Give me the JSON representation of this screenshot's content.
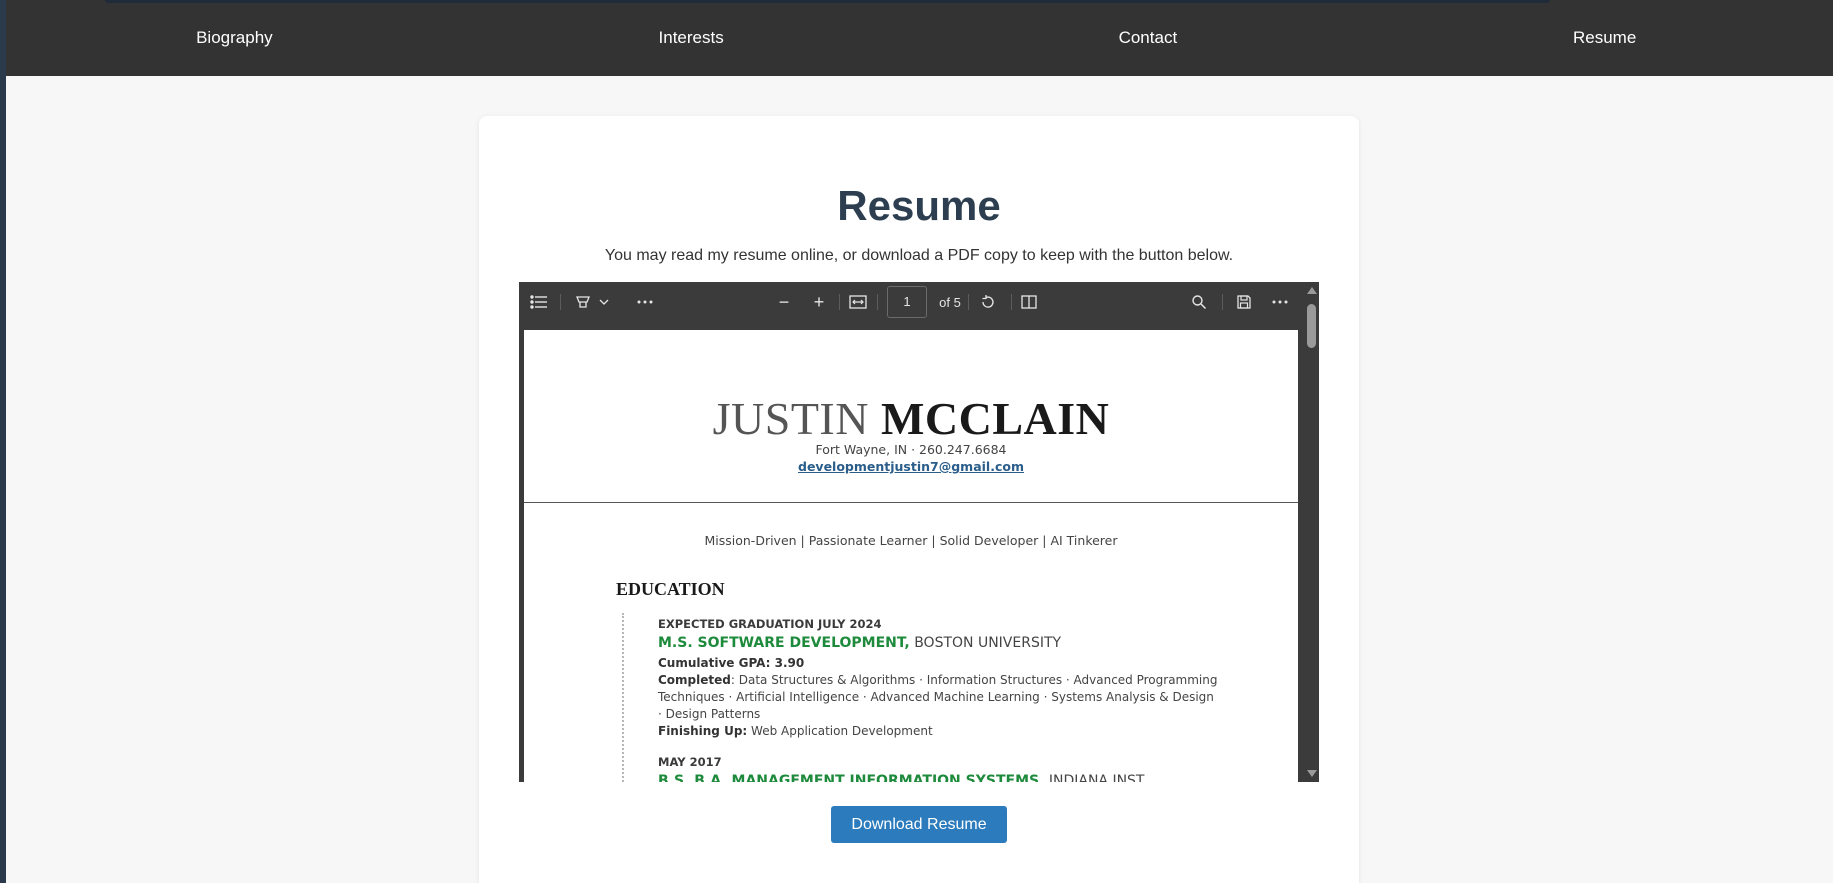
{
  "nav": {
    "items": [
      "Biography",
      "Interests",
      "Contact",
      "Resume"
    ]
  },
  "resume_section": {
    "title": "Resume",
    "subtitle": "You may read my resume online, or download a PDF copy to keep with the button below.",
    "download_label": "Download Resume"
  },
  "pdf_viewer": {
    "toolbar": {
      "contents_icon": "list-icon",
      "highlight_icon": "highlighter-icon",
      "more_icon": "more-icon",
      "zoom_out": "−",
      "zoom_in": "+",
      "fit_icon": "fit-width-icon",
      "current_page": "1",
      "page_total": "of 5",
      "rotate_icon": "rotate-icon",
      "page_view_icon": "page-view-icon",
      "search_icon": "search-icon",
      "save_icon": "save-icon"
    },
    "document": {
      "first_name": "JUSTIN",
      "last_name": "MCCLAIN",
      "contact": "Fort Wayne, IN · 260.247.6684",
      "email": "developmentjustin7@gmail.com",
      "tagline": "Mission-Driven | Passionate Learner | Solid Developer | AI Tinkerer",
      "education_heading": "EDUCATION",
      "entries": [
        {
          "date": "EXPECTED GRADUATION JULY 2024",
          "degree": "M.S. SOFTWARE DEVELOPMENT,",
          "school": "BOSTON UNIVERSITY",
          "gpa_label": "Cumulative GPA: 3.90",
          "completed_label": "Completed",
          "completed_text": ": Data Structures & Algorithms · Information Structures · Advanced Programming Techniques · Artificial Intelligence · Advanced Machine Learning ·  Systems Analysis & Design · Design Patterns",
          "finishing_label": "Finishing Up:",
          "finishing_text": " Web Application Development"
        },
        {
          "date": "MAY 2017",
          "degree": "B.S. B.A. MANAGEMENT INFORMATION SYSTEMS,",
          "school": "INDIANA INST. TECHNOLOGY"
        }
      ]
    }
  },
  "colors": {
    "nav_bg": "#333333",
    "title": "#2c3e50",
    "button": "#2b7bbd",
    "degree_green": "#1e8a3c"
  }
}
